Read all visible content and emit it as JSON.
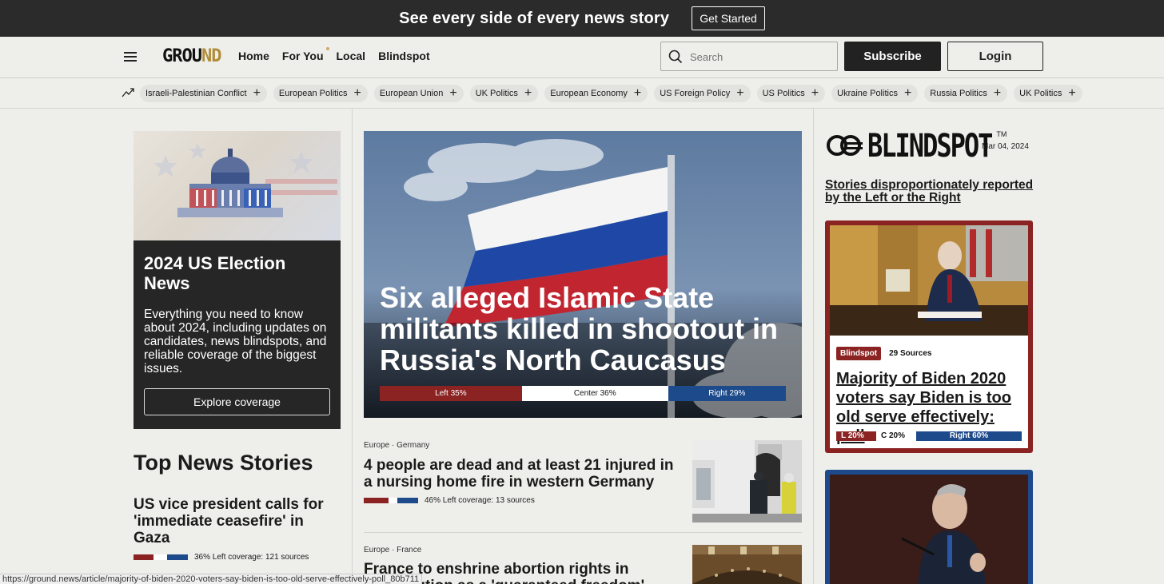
{
  "promo": {
    "text": "See every side of every news story",
    "cta": "Get Started"
  },
  "nav": {
    "logo_a": "GROU",
    "logo_b": "ND",
    "links": [
      "Home",
      "For You",
      "Local",
      "Blindspot"
    ],
    "search_placeholder": "Search",
    "subscribe": "Subscribe",
    "login": "Login"
  },
  "topics": [
    "Israeli-Palestinian Conflict",
    "European Politics",
    "European Union",
    "UK Politics",
    "European Economy",
    "US Foreign Policy",
    "US Politics",
    "Ukraine Politics",
    "Russia Politics",
    "UK Politics"
  ],
  "election": {
    "title": "2024 US Election News",
    "desc": "Everything you need to know about 2024, including updates on candidates, news blindspots, and reliable coverage of the biggest issues.",
    "cta": "Explore coverage"
  },
  "top_news": {
    "heading": "Top News Stories",
    "story": {
      "title": "US vice president calls for 'immediate ceasefire' in Gaza",
      "meta": "36% Left coverage: 121 sources"
    }
  },
  "hero": {
    "title": "Six alleged Islamic State militants killed in shootout in Russia's North Caucasus",
    "bias": {
      "left": "Left 35%",
      "center": "Center 36%",
      "right": "Right 29%",
      "left_pct": 35,
      "center_pct": 36,
      "right_pct": 29
    }
  },
  "articles": [
    {
      "category": "Europe · Germany",
      "title": "4 people are dead and at least 21 injured in a nursing home fire in western Germany",
      "meta": "46% Left coverage: 13 sources"
    },
    {
      "category": "Europe · France",
      "title": "France to enshrine abortion rights in Constitution as a 'guaranteed freedom'"
    }
  ],
  "blindspot": {
    "logo": "BLINDSPOT",
    "tm": "TM",
    "date": "Mar 04, 2024",
    "tagline": "Stories disproportionately reported by the Left or the Right",
    "card": {
      "tag": "Blindspot",
      "sources": "29 Sources",
      "title": "Majority of Biden 2020 voters say Biden is too old serve effectively: poll",
      "left": "L 20%",
      "center": "C 20%",
      "right": "Right 60%",
      "left_pct": 20,
      "center_pct": 20,
      "right_pct": 60
    }
  },
  "statusbar": "https://ground.news/article/majority-of-biden-2020-voters-say-biden-is-too-old-serve-effectively-poll_80b711",
  "colors": {
    "left": "#8b2323",
    "right": "#1d4a8a",
    "center": "#ffffff",
    "dark": "#262626"
  }
}
